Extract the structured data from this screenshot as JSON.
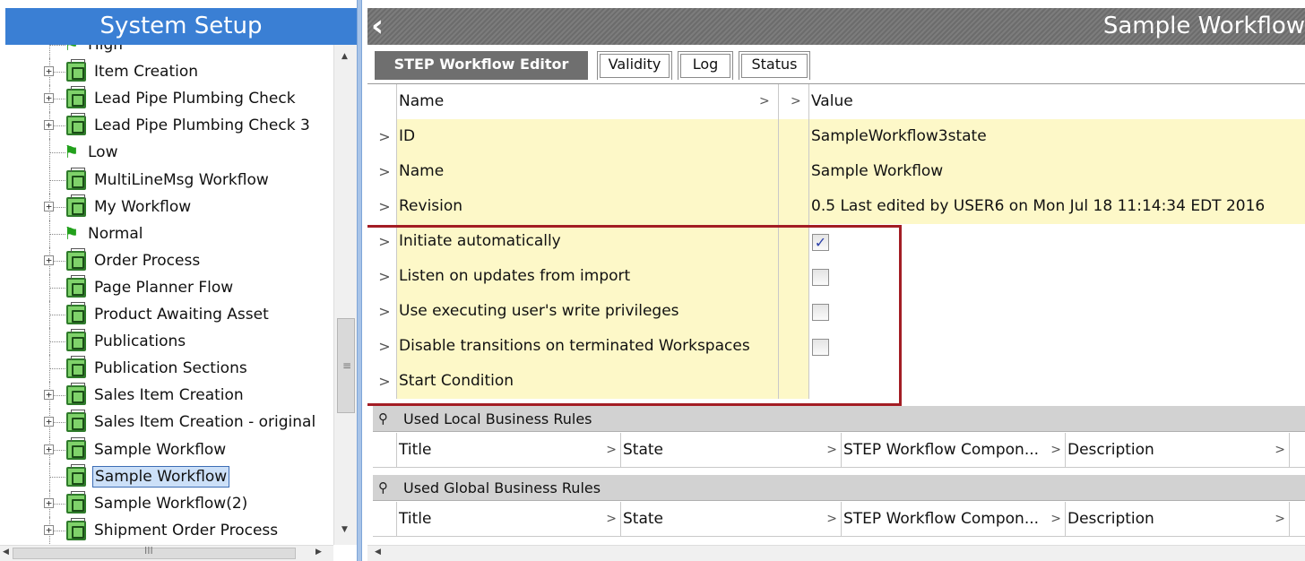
{
  "left_panel": {
    "title": "System Setup",
    "tree": [
      {
        "label": "High",
        "icon": "flag-icon",
        "expander": "",
        "partial": true
      },
      {
        "label": "Item Creation",
        "icon": "workflow-icon",
        "expander": "+"
      },
      {
        "label": "Lead Pipe Plumbing Check",
        "icon": "workflow-icon",
        "expander": "+"
      },
      {
        "label": "Lead Pipe Plumbing Check 3",
        "icon": "workflow-icon",
        "expander": "+"
      },
      {
        "label": "Low",
        "icon": "flag-icon",
        "expander": ""
      },
      {
        "label": "MultiLineMsg Workflow",
        "icon": "workflow-icon",
        "expander": ""
      },
      {
        "label": "My Workflow",
        "icon": "workflow-icon",
        "expander": "+"
      },
      {
        "label": "Normal",
        "icon": "flag-icon",
        "expander": ""
      },
      {
        "label": "Order Process",
        "icon": "workflow-icon",
        "expander": "+"
      },
      {
        "label": "Page Planner Flow",
        "icon": "workflow-icon",
        "expander": ""
      },
      {
        "label": "Product Awaiting Asset",
        "icon": "workflow-icon",
        "expander": ""
      },
      {
        "label": "Publications",
        "icon": "workflow-icon",
        "expander": ""
      },
      {
        "label": "Publication Sections",
        "icon": "workflow-icon",
        "expander": ""
      },
      {
        "label": "Sales Item Creation",
        "icon": "workflow-icon",
        "expander": "+"
      },
      {
        "label": "Sales Item Creation - original",
        "icon": "workflow-icon",
        "expander": "+"
      },
      {
        "label": "Sample Workflow",
        "icon": "workflow-icon",
        "expander": "+"
      },
      {
        "label": "Sample Workflow",
        "icon": "workflow-icon",
        "expander": "",
        "selected": true
      },
      {
        "label": "Sample Workflow(2)",
        "icon": "workflow-icon",
        "expander": "+"
      },
      {
        "label": "Shipment Order Process",
        "icon": "workflow-icon",
        "expander": "+"
      }
    ]
  },
  "right_panel": {
    "title": "Sample Workflow",
    "tabs": [
      {
        "label": "STEP Workflow Editor",
        "active": true
      },
      {
        "label": "Validity",
        "active": false
      },
      {
        "label": "Log",
        "active": false
      },
      {
        "label": "Status",
        "active": false
      }
    ],
    "properties": {
      "header": {
        "name": "Name",
        "value": "Value"
      },
      "rows": [
        {
          "name": "ID",
          "value": "SampleWorkflow3state"
        },
        {
          "name": "Name",
          "value": "Sample Workflow"
        },
        {
          "name": "Revision",
          "value": "0.5 Last edited by USER6 on Mon Jul 18 11:14:34 EDT 2016"
        },
        {
          "name": "Initiate automatically",
          "checked": true
        },
        {
          "name": "Listen on updates from import",
          "checked": false
        },
        {
          "name": "Use executing user's write privileges",
          "checked": false
        },
        {
          "name": "Disable transitions on terminated Workspaces",
          "checked": false
        },
        {
          "name": "Start Condition",
          "value": ""
        }
      ]
    },
    "local_rules": {
      "title": "Used Local Business Rules",
      "columns": [
        "Title",
        "State",
        "STEP Workflow Compon...",
        "Description"
      ]
    },
    "global_rules": {
      "title": "Used Global Business Rules",
      "columns": [
        "Title",
        "State",
        "STEP Workflow Compon...",
        "Description"
      ]
    }
  },
  "colors": {
    "title_blue": "#3a7fd4",
    "header_gray": "#6f6f6f",
    "cell_yellow": "#fdf8c8",
    "highlight_red": "#a31d24",
    "selection_blue": "#cce0f8"
  }
}
